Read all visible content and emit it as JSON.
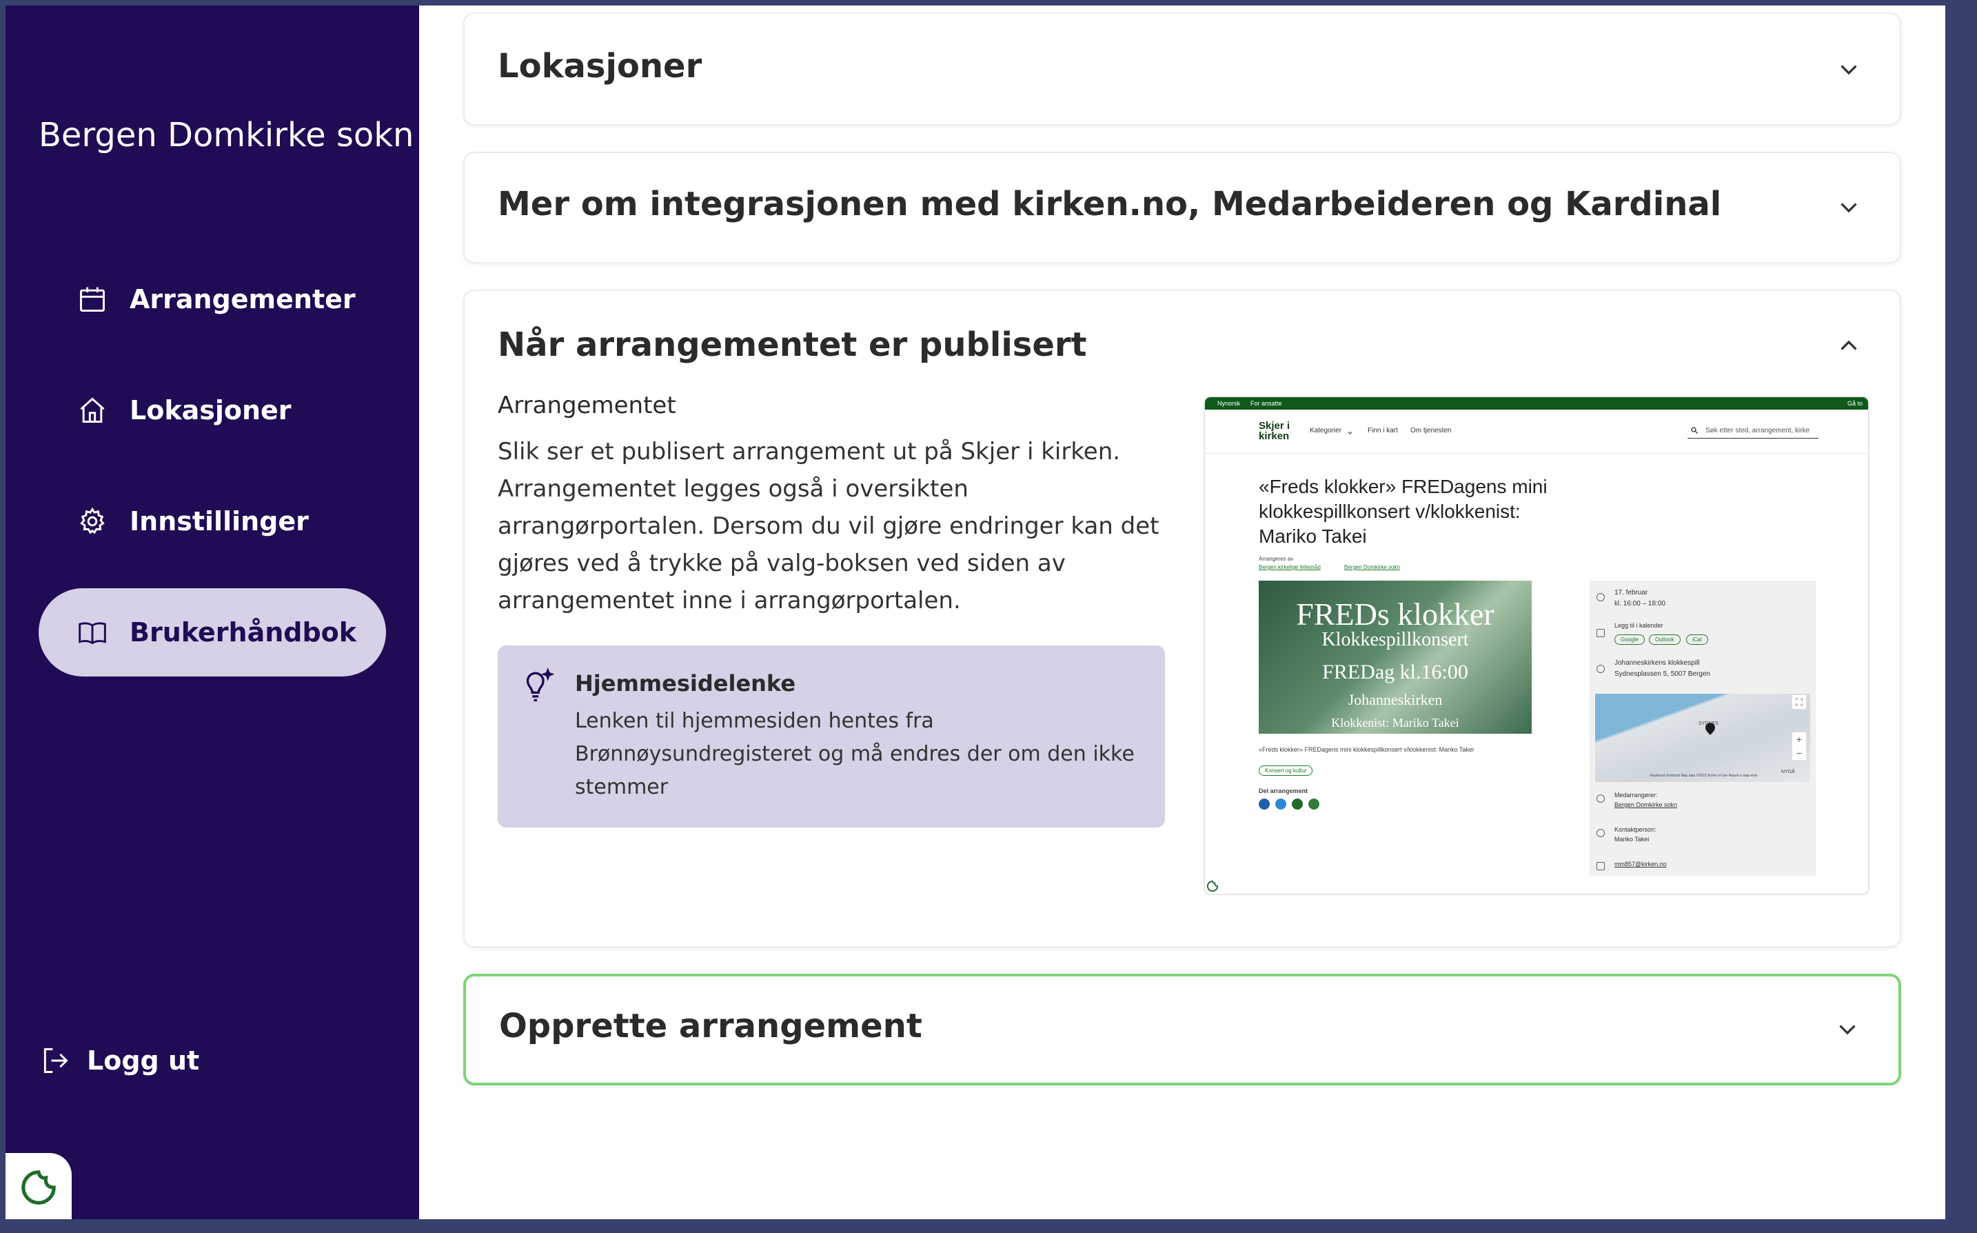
{
  "sidebar": {
    "org_name": "Bergen Domkirke sokn",
    "items": [
      {
        "label": "Arrangementer",
        "icon": "calendar-icon"
      },
      {
        "label": "Lokasjoner",
        "icon": "home-icon"
      },
      {
        "label": "Innstillinger",
        "icon": "gear-icon"
      },
      {
        "label": "Brukerhåndbok",
        "icon": "book-icon",
        "active": true
      }
    ],
    "logout_label": "Logg ut"
  },
  "sections": {
    "lokasjoner": {
      "title": "Lokasjoner",
      "expanded": false
    },
    "integrasjon": {
      "title": "Mer om integrasjonen med kirken.no, Medarbeideren og Kardinal",
      "expanded": false
    },
    "publisert": {
      "title": "Når arrangementet er publisert",
      "expanded": true,
      "subtitle": "Arrangementet",
      "body": "Slik ser et publisert arrangement ut på Skjer i kirken. Arrangementet legges også i oversikten arrangørportalen. Dersom du vil gjøre endringer kan det gjøres ved å trykke på valg-boksen ved siden av arrangementet inne i arrangørportalen.",
      "tip": {
        "title": "Hjemmesidelenke",
        "text": "Lenken til hjemmesiden hentes fra Brønnøysundregisteret og må endres der om den ikke stemmer"
      }
    },
    "opprette": {
      "title": "Opprette arrangement",
      "expanded": false
    }
  },
  "preview": {
    "topbar": {
      "left1": "Nynorsk",
      "left2": "For ansatte",
      "right": "Gå to"
    },
    "logo": "Skjer i kirken",
    "menu": [
      "Kategorier",
      "Finn i kart",
      "Om tjenesten"
    ],
    "search_placeholder": "Søk etter sted, arrangement, kirke",
    "event_title": "«Freds klokker» FREDagens mini klokkespillkonsert v/klokkenist: Mariko Takei",
    "arranged_by": "Arrangeres av",
    "organizers": [
      "Bergen kirkelige fellesråd",
      "Bergen Domkirke sokn"
    ],
    "poster": {
      "line1": "FREDs klokker",
      "line2": "Klokkespillkonsert",
      "line3": "FREDag kl.16:00",
      "line4": "Johanneskirken",
      "line5": "Klokkenist: Mariko Takei"
    },
    "caption": "«Freds klokker» FREDagens mini klokkespillkonsert v/klokkenist: Mariko Takei",
    "category_tag": "Konsert og kultur",
    "share_label": "Del arrangement",
    "date": "17. februar",
    "time": "kl. 16:00 – 18:00",
    "add_calendar": "Legg til i kalender",
    "calendar_options": [
      "Google",
      "Outlook",
      "iCal"
    ],
    "location_name": "Johanneskirkens klokkespill",
    "location_address": "Sydnesplassen 5, 5007 Bergen",
    "co_organizers_label": "Medarrangører:",
    "co_organizer": "Bergen Domkirke sokn",
    "contact_label": "Kontaktperson:",
    "contact_name": "Mariko Takei",
    "email": "mm857@kirken.no",
    "map_labels": [
      "SYDNES",
      "NYGÅ"
    ],
    "map_footer": "Keyboard shortcuts   Map data ©2023   Terms of Use   Report a map error"
  }
}
